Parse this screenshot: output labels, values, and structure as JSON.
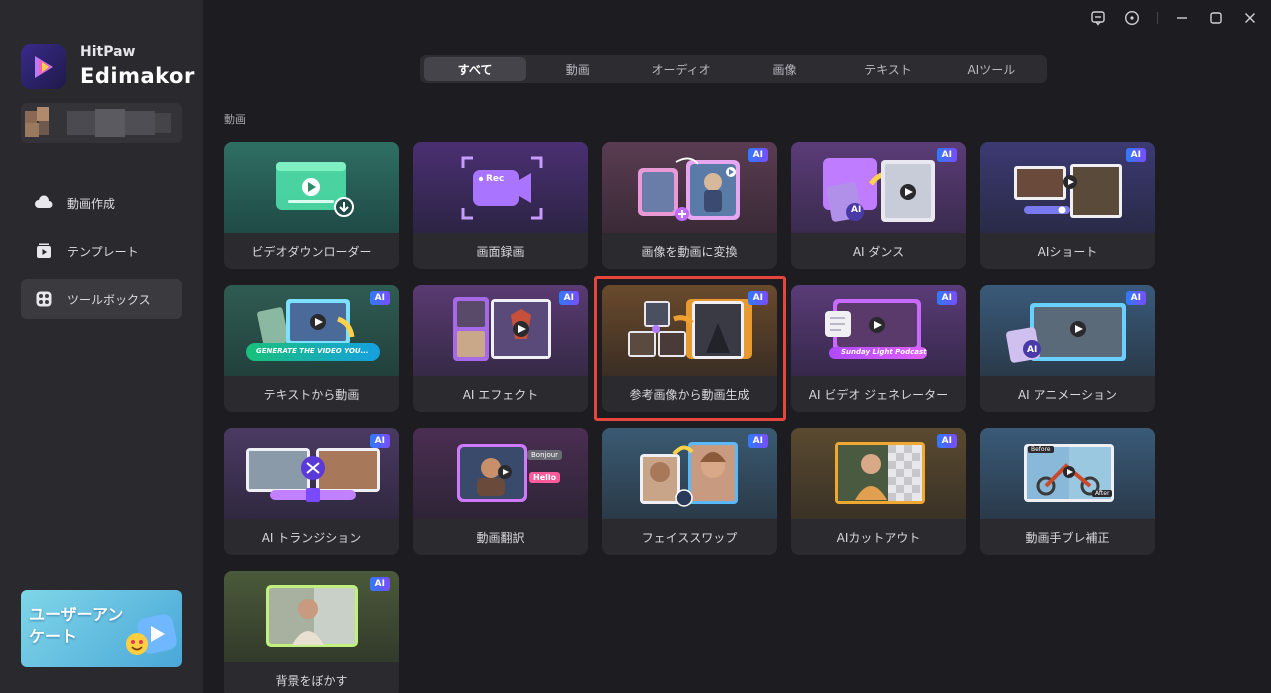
{
  "brand": {
    "line1": "HitPaw",
    "line2": "Edimakor"
  },
  "sidebar": {
    "items": [
      {
        "label": "動画作成",
        "icon": "cloud-upload-icon"
      },
      {
        "label": "テンプレート",
        "icon": "template-play-icon"
      },
      {
        "label": "ツールボックス",
        "icon": "toolbox-icon",
        "active": true
      }
    ],
    "survey": {
      "text": "ユーザーアンケート"
    }
  },
  "window_controls": [
    "feedback-icon",
    "help-icon",
    "minimize-icon",
    "maximize-icon",
    "close-icon"
  ],
  "tabs": [
    "すべて",
    "動画",
    "オーディオ",
    "画像",
    "テキスト",
    "AIツール"
  ],
  "active_tab": "すべて",
  "section": {
    "label": "動画"
  },
  "ai_badge": "AI",
  "cards": [
    {
      "label": "ビデオダウンローダー",
      "ai": false
    },
    {
      "label": "画面録画",
      "ai": false,
      "rec": "Rec"
    },
    {
      "label": "画像を動画に変換",
      "ai": true
    },
    {
      "label": "AI ダンス",
      "ai": true
    },
    {
      "label": "AIショート",
      "ai": true
    },
    {
      "label": "テキストから動画",
      "ai": true,
      "prompt": "GENERATE THE VIDEO YOU..."
    },
    {
      "label": "AI エフェクト",
      "ai": true
    },
    {
      "label": "参考画像から動画生成",
      "ai": true
    },
    {
      "label": "AI ビデオ ジェネレーター",
      "ai": true,
      "caption": "Sunday Light Podcast"
    },
    {
      "label": "AI アニメーション",
      "ai": true
    },
    {
      "label": "AI トランジション",
      "ai": true
    },
    {
      "label": "動画翻訳",
      "ai": false,
      "words": [
        "Hello",
        "Bonjour"
      ]
    },
    {
      "label": "フェイススワップ",
      "ai": true
    },
    {
      "label": "AIカットアウト",
      "ai": true
    },
    {
      "label": "動画手ブレ補正",
      "ai": false,
      "before": "Before",
      "after": "After"
    },
    {
      "label": "背景をぼかす",
      "ai": true
    }
  ],
  "colors": {
    "accent_highlight": "#e8463d",
    "ai_badge_start": "#2f7bff",
    "ai_badge_end": "#7a4cff"
  }
}
